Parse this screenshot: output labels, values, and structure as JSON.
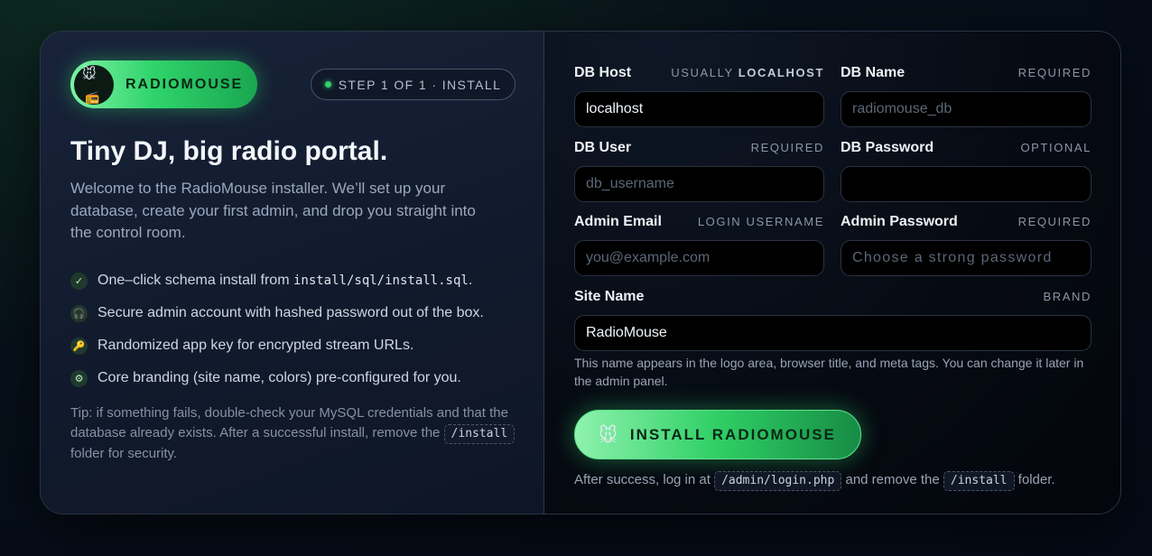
{
  "brand": {
    "name": "RADIOMOUSE",
    "logo_icon": "mouse-face-icon",
    "logo_secondary_icon": "radio-icon",
    "accent": "#2fd36b"
  },
  "step": {
    "label": "STEP 1 OF 1 · INSTALL"
  },
  "hero": {
    "title": "Tiny DJ, big radio portal.",
    "intro": "Welcome to the RadioMouse installer. We’ll set up your database, create your first admin, and drop you straight into the control room."
  },
  "features": [
    {
      "icon": "check-icon",
      "text_before": "One–click schema install from ",
      "code": "install/sql/install.sql",
      "text_after": "."
    },
    {
      "icon": "headphones-icon",
      "text": "Secure admin account with hashed password out of the box."
    },
    {
      "icon": "key-icon",
      "text": "Randomized app key for encrypted stream URLs."
    },
    {
      "icon": "gear-icon",
      "text": "Core branding (site name, colors) pre-configured for you."
    }
  ],
  "tip": {
    "text_before": "Tip: if something fails, double-check your MySQL credentials and that the database already exists. After a successful install, remove the ",
    "code": "/install",
    "text_after": " folder for security."
  },
  "form": {
    "db_host": {
      "label": "DB Host",
      "hint_prefix": "USUALLY ",
      "hint_bold": "LOCALHOST",
      "value": "localhost",
      "placeholder": ""
    },
    "db_name": {
      "label": "DB Name",
      "hint": "REQUIRED",
      "value": "",
      "placeholder": "radiomouse_db"
    },
    "db_user": {
      "label": "DB User",
      "hint": "REQUIRED",
      "value": "",
      "placeholder": "db_username"
    },
    "db_password": {
      "label": "DB Password",
      "hint": "OPTIONAL",
      "value": "",
      "placeholder": ""
    },
    "admin_email": {
      "label": "Admin Email",
      "hint": "LOGIN USERNAME",
      "value": "",
      "placeholder": "you@example.com"
    },
    "admin_password": {
      "label": "Admin Password",
      "hint": "REQUIRED",
      "value": "",
      "placeholder": "Choose a strong password"
    },
    "site_name": {
      "label": "Site Name",
      "hint": "BRAND",
      "value": "RadioMouse",
      "placeholder": ""
    },
    "site_name_help": "This name appears in the logo area, browser title, and meta tags. You can change it later in the admin panel."
  },
  "install_button": {
    "label": "INSTALL RADIOMOUSE",
    "icon": "mouse-face-icon"
  },
  "after": {
    "text_before": "After success, log in at ",
    "code1": "/admin/login.php",
    "text_middle": " and remove the ",
    "code2": "/install",
    "text_after": " folder."
  }
}
